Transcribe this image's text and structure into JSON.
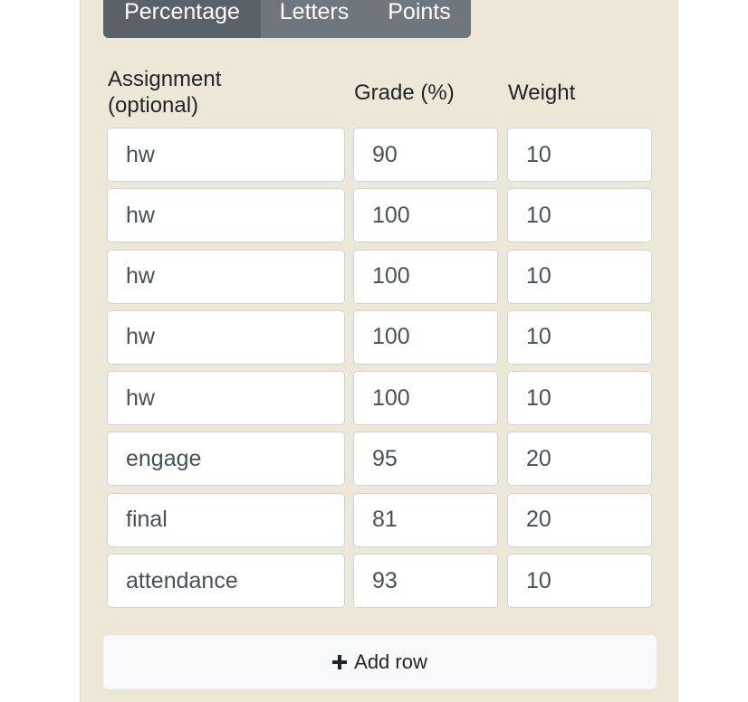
{
  "tabs": [
    {
      "label": "Percentage",
      "active": true
    },
    {
      "label": "Letters",
      "active": false
    },
    {
      "label": "Points",
      "active": false
    }
  ],
  "headers": {
    "assignment": "Assignment\n(optional)",
    "grade": "Grade (%)",
    "weight": "Weight"
  },
  "rows": [
    {
      "assignment": "hw",
      "grade": "90",
      "weight": "10"
    },
    {
      "assignment": "hw",
      "grade": "100",
      "weight": "10"
    },
    {
      "assignment": "hw",
      "grade": "100",
      "weight": "10"
    },
    {
      "assignment": "hw",
      "grade": "100",
      "weight": "10"
    },
    {
      "assignment": "hw",
      "grade": "100",
      "weight": "10"
    },
    {
      "assignment": "engage",
      "grade": "95",
      "weight": "20"
    },
    {
      "assignment": "final",
      "grade": "81",
      "weight": "20"
    },
    {
      "assignment": "attendance",
      "grade": "93",
      "weight": "10"
    }
  ],
  "add_row": {
    "label": "Add row",
    "icon": "plus-icon"
  },
  "colors": {
    "panel_bg": "#ede7d8",
    "tab_active": "#5b6168",
    "tab_inactive": "#6f767d"
  }
}
